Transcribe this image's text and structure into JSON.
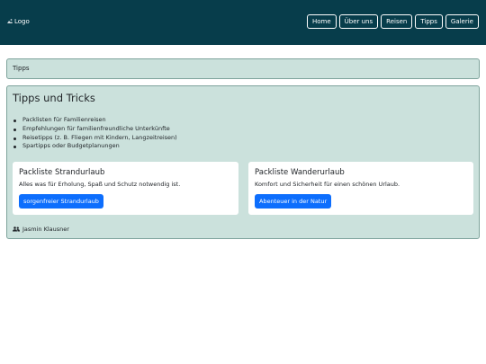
{
  "header": {
    "logo_alt": "Logo",
    "nav": [
      "Home",
      "Über uns",
      "Reisen",
      "Tipps",
      "Galerie"
    ]
  },
  "breadcrumb": "Tipps",
  "main": {
    "title": "Tipps und Tricks",
    "tips": [
      "Packlisten für Familienreisen",
      "Empfehlungen für familienfreundliche Unterkünfte",
      "Reisetipps (z. B. Fliegen mit Kindern, Langzeitreisen)",
      "Spartipps oder Budgetplanungen"
    ],
    "cards": [
      {
        "title": "Packliste Strandurlaub",
        "text": "Alles was für Erholung, Spaß und Schutz notwendig ist.",
        "button": "sorgenfreier Strandurlaub"
      },
      {
        "title": "Packliste Wanderurlaub",
        "text": "Komfort und Sicherheit für einen schönen Urlaub.",
        "button": "Abenteuer in der Natur"
      }
    ],
    "author": "Jasmin Klausner",
    "author_icon": "people-icon"
  },
  "colors": {
    "header_bg": "#073d4b",
    "panel_bg": "#cbe1dc",
    "panel_border": "#7ea39c",
    "button_primary": "#0d6efd"
  }
}
